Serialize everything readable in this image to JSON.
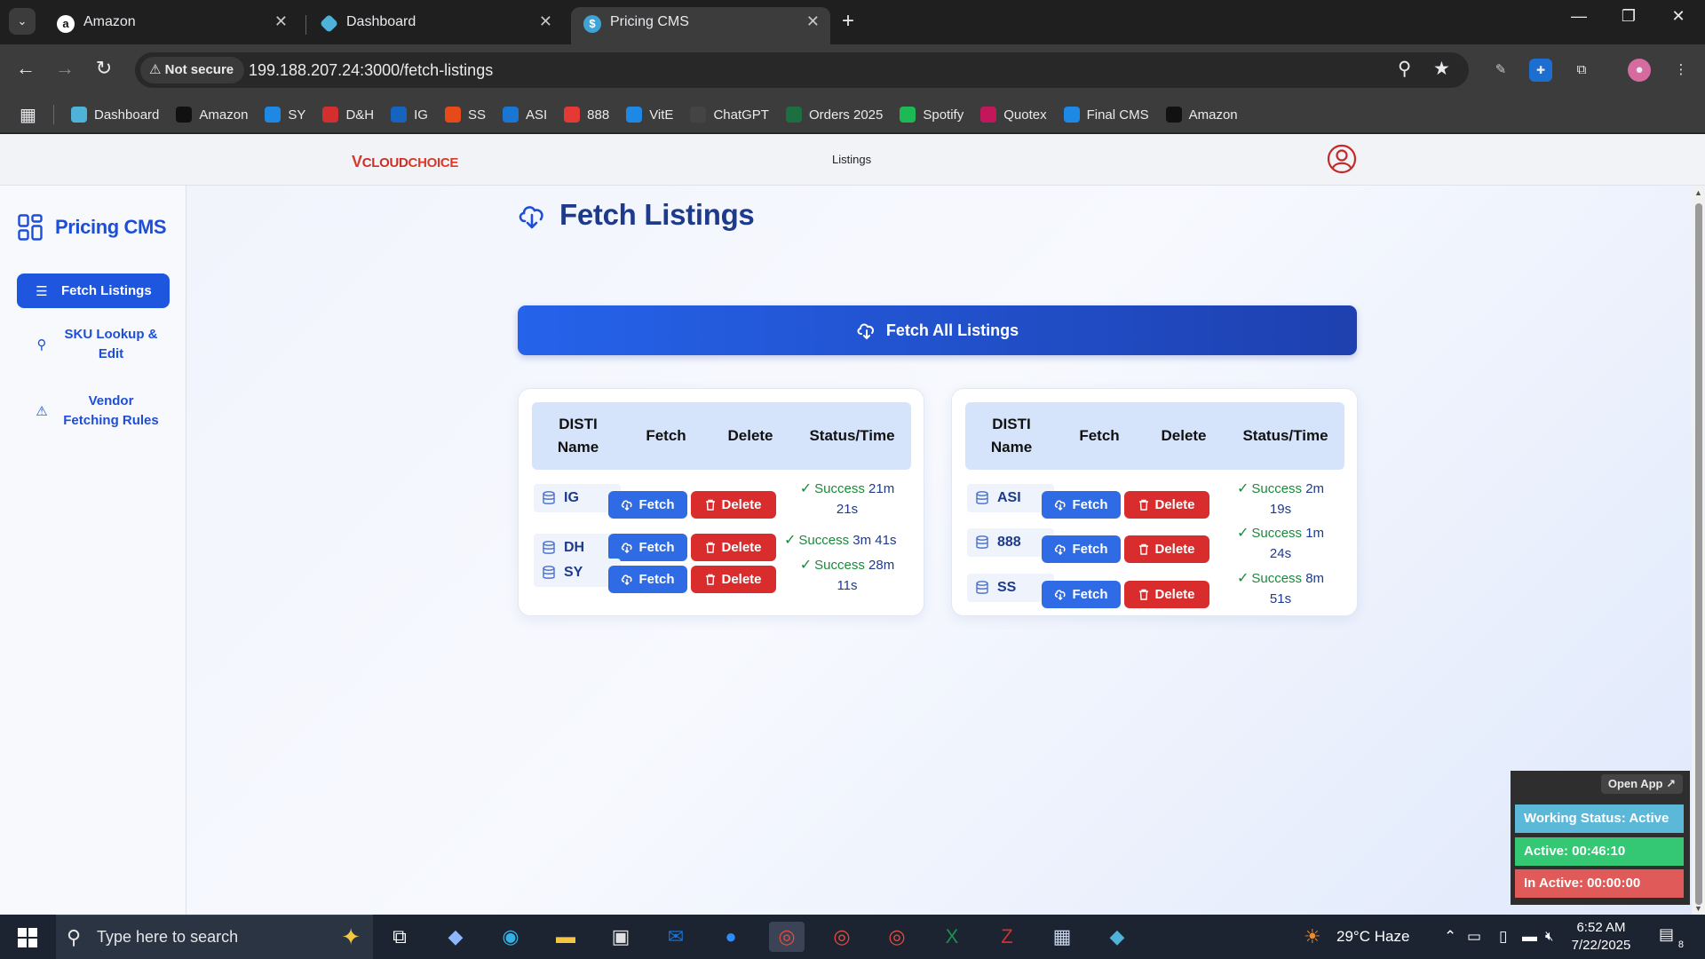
{
  "browser": {
    "tabs": [
      {
        "title": "Amazon",
        "favicon": "amazon-icon",
        "active": false
      },
      {
        "title": "Dashboard",
        "favicon": "dashboard-diamond-icon",
        "active": false
      },
      {
        "title": "Pricing CMS",
        "favicon": "dollar-circle-icon",
        "active": true
      }
    ],
    "security_label": "Not secure",
    "url": "199.188.207.24:3000/fetch-listings",
    "bookmarks": [
      {
        "label": "Dashboard",
        "icon": "diamond-icon",
        "color": "#4fb3d9"
      },
      {
        "label": "Amazon",
        "icon": "amazon-icon",
        "color": "#111111"
      },
      {
        "label": "SY",
        "icon": "ec-icon",
        "color": "#1e88e5"
      },
      {
        "label": "D&H",
        "icon": "dh-icon",
        "color": "#d32f2f"
      },
      {
        "label": "IG",
        "icon": "ig-icon",
        "color": "#1565c0"
      },
      {
        "label": "SS",
        "icon": "ss-icon",
        "color": "#e64a19"
      },
      {
        "label": "ASI",
        "icon": "asi-icon",
        "color": "#1976d2"
      },
      {
        "label": "888",
        "icon": "888-icon",
        "color": "#e53935"
      },
      {
        "label": "VitE",
        "icon": "dollar-icon",
        "color": "#1e88e5"
      },
      {
        "label": "ChatGPT",
        "icon": "chatgpt-icon",
        "color": "#444444"
      },
      {
        "label": "Orders 2025",
        "icon": "excel-icon",
        "color": "#1d6f42"
      },
      {
        "label": "Spotify",
        "icon": "spotify-icon",
        "color": "#1db954"
      },
      {
        "label": "Quotex",
        "icon": "quotex-icon",
        "color": "#c2185b"
      },
      {
        "label": "Final CMS",
        "icon": "dollar-icon",
        "color": "#1e88e5"
      },
      {
        "label": "Amazon",
        "icon": "amazon-icon",
        "color": "#111111"
      }
    ]
  },
  "app": {
    "logo_text": "CLOUDCHOICE",
    "nav_link": "Listings",
    "brand": "Pricing CMS",
    "sidebar": [
      {
        "label": "Fetch Listings",
        "icon": "list-icon",
        "active": true
      },
      {
        "label": "SKU Lookup & Edit",
        "icon": "search-icon",
        "active": false
      },
      {
        "label": "Vendor Fetching Rules",
        "icon": "warning-icon",
        "active": false
      }
    ],
    "page_title": "Fetch Listings",
    "fetch_all_label": "Fetch All Listings",
    "table_headers": {
      "name": "DISTI Name",
      "fetch": "Fetch",
      "delete": "Delete",
      "status": "Status/Time"
    },
    "fetch_label": "Fetch",
    "delete_label": "Delete",
    "left_rows": [
      {
        "name": "IG",
        "status": "Success",
        "time": "21m 21s"
      },
      {
        "name": "DH",
        "status": "Success",
        "time": "3m 41s"
      },
      {
        "name": "SY",
        "status": "Success",
        "time": "28m 11s"
      }
    ],
    "right_rows": [
      {
        "name": "ASI",
        "status": "Success",
        "time": "2m 19s"
      },
      {
        "name": "888",
        "status": "Success",
        "time": "1m 24s"
      },
      {
        "name": "SS",
        "status": "Success",
        "time": "8m 51s"
      }
    ]
  },
  "widget": {
    "open_app": "Open App ↗",
    "working_status": "Working Status: Active",
    "active_time": "Active: 00:46:10",
    "inactive_time": "In Active: 00:00:00",
    "colors": {
      "working": "#5bb8d8",
      "active": "#34c874",
      "inactive": "#e05a5a"
    }
  },
  "taskbar": {
    "search_placeholder": "Type here to search",
    "weather": "29°C  Haze",
    "time": "6:52 AM",
    "date": "7/22/2025",
    "notifications": "8"
  }
}
